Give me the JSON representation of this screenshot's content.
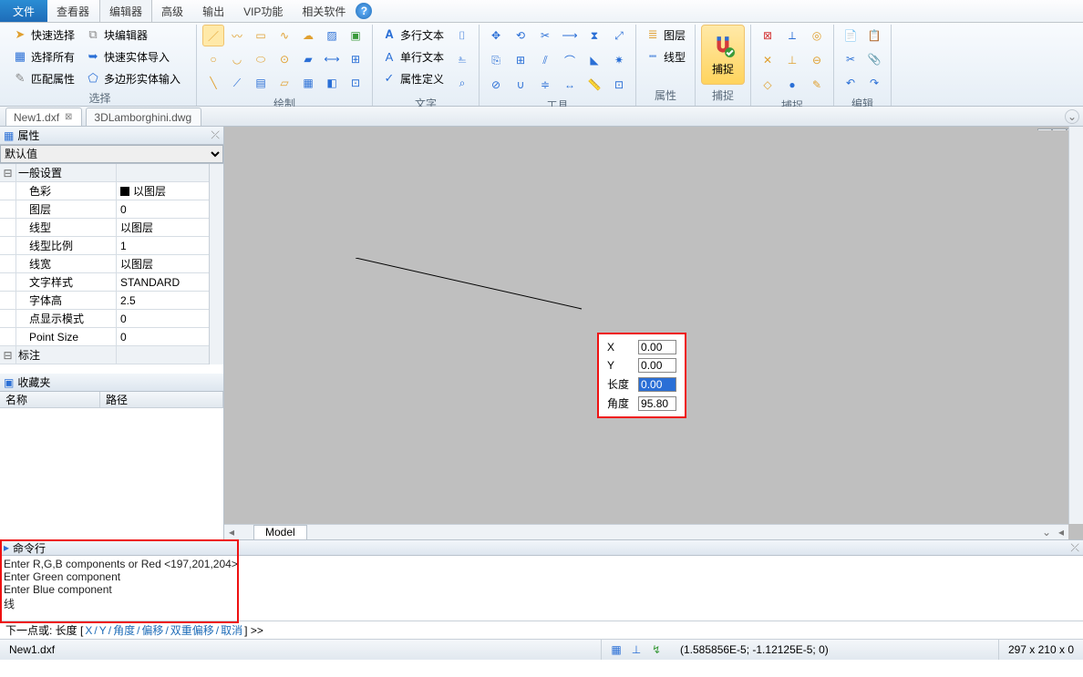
{
  "menu": {
    "file": "文件",
    "viewer": "查看器",
    "editor": "编辑器",
    "advanced": "高级",
    "output": "输出",
    "vip": "VIP功能",
    "related": "相关软件"
  },
  "ribbon": {
    "select": {
      "quick": "快速选择",
      "block": "块编辑器",
      "all": "选择所有",
      "import": "快速实体导入",
      "match": "匹配属性",
      "poly": "多边形实体输入",
      "label": "选择"
    },
    "draw": {
      "label": "绘制"
    },
    "text": {
      "multi": "多行文本",
      "single": "单行文本",
      "attr": "属性定义",
      "label": "文字"
    },
    "tools": {
      "label": "工具"
    },
    "props": {
      "layer": "图层",
      "ltype": "线型",
      "label": "属性"
    },
    "snap": {
      "btn": "捕捉",
      "label": "捕捉"
    },
    "edit": {
      "label": "编辑"
    }
  },
  "tabs": {
    "t1": "New1.dxf",
    "t2": "3DLamborghini.dwg"
  },
  "panel": {
    "title": "属性",
    "default": "默认值",
    "sec1": "一般设置",
    "sec2": "标注",
    "rows": [
      {
        "k": "色彩",
        "v": "以图层",
        "sw": true
      },
      {
        "k": "图层",
        "v": "0"
      },
      {
        "k": "线型",
        "v": "以图层"
      },
      {
        "k": "线型比例",
        "v": "1"
      },
      {
        "k": "线宽",
        "v": "以图层"
      },
      {
        "k": "文字样式",
        "v": "STANDARD"
      },
      {
        "k": "字体高",
        "v": "2.5"
      },
      {
        "k": "点显示模式",
        "v": "0"
      },
      {
        "k": "Point Size",
        "v": "0"
      }
    ],
    "fav": "收藏夹",
    "col_name": "名称",
    "col_path": "路径"
  },
  "canvas": {
    "model": "Model",
    "float": {
      "x_lbl": "X",
      "y_lbl": "Y",
      "len_lbl": "长度",
      "ang_lbl": "角度",
      "x": "0.00",
      "y": "0.00",
      "len": "0.00",
      "ang": "95.80"
    }
  },
  "cmd": {
    "title": "命令行",
    "l1": "Enter R,G,B components or Red <197,201,204>",
    "l2": "Enter Green component",
    "l3": "Enter Blue component",
    "l4": "线",
    "prompt_pre": "下一点或:  长度  [ ",
    "opt_x": "X",
    "opt_y": "Y",
    "opt_ang": "角度",
    "opt_off": "偏移",
    "opt_doff": "双重偏移",
    "opt_cancel": "取消",
    "prompt_post": " ]  >>"
  },
  "status": {
    "file": "New1.dxf",
    "coords": "(1.585856E-5; -1.12125E-5; 0)",
    "dims": "297 x 210 x 0"
  }
}
